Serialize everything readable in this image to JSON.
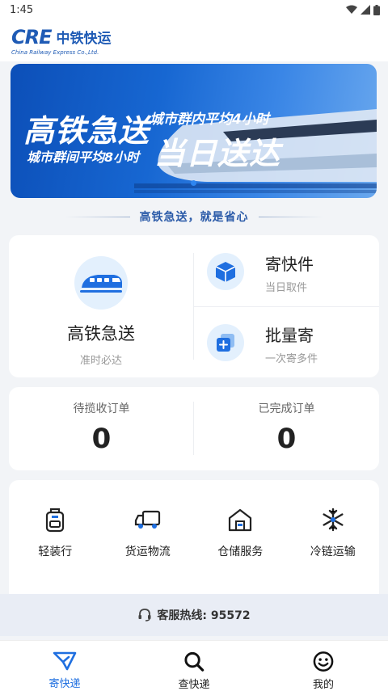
{
  "status": {
    "time": "1:45"
  },
  "header": {
    "logo_mark": "CRE",
    "logo_cn": "中铁快运",
    "logo_en": "China Railway Express Co.,Ltd."
  },
  "banner": {
    "title1": "高铁急送",
    "subtitle1": "城市群内平均4小时",
    "title2": "当日送达",
    "subtitle2": "城市群间平均8小时"
  },
  "slogan": "高铁急送，就是省心",
  "services": {
    "main": {
      "name": "高铁急送",
      "desc": "准时必达",
      "icon": "high-speed-train-icon"
    },
    "side": [
      {
        "name": "寄快件",
        "desc": "当日取件",
        "icon": "package-icon"
      },
      {
        "name": "批量寄",
        "desc": "一次寄多件",
        "icon": "batch-add-icon"
      }
    ]
  },
  "orders": [
    {
      "label": "待揽收订单",
      "count": "0"
    },
    {
      "label": "已完成订单",
      "count": "0"
    }
  ],
  "tools": [
    {
      "label": "轻装行",
      "icon": "backpack-icon"
    },
    {
      "label": "货运物流",
      "icon": "truck-icon"
    },
    {
      "label": "仓储服务",
      "icon": "warehouse-icon"
    },
    {
      "label": "冷链运输",
      "icon": "snowflake-icon"
    }
  ],
  "hotline": {
    "text": "客服热线: 95572",
    "icon": "headset-icon"
  },
  "tabs": [
    {
      "label": "寄快递",
      "icon": "send-icon",
      "active": true
    },
    {
      "label": "查快递",
      "icon": "search-icon",
      "active": false
    },
    {
      "label": "我的",
      "icon": "smiley-icon",
      "active": false
    }
  ],
  "colors": {
    "accent": "#1f6fe0",
    "brand": "#1f5bb5"
  }
}
